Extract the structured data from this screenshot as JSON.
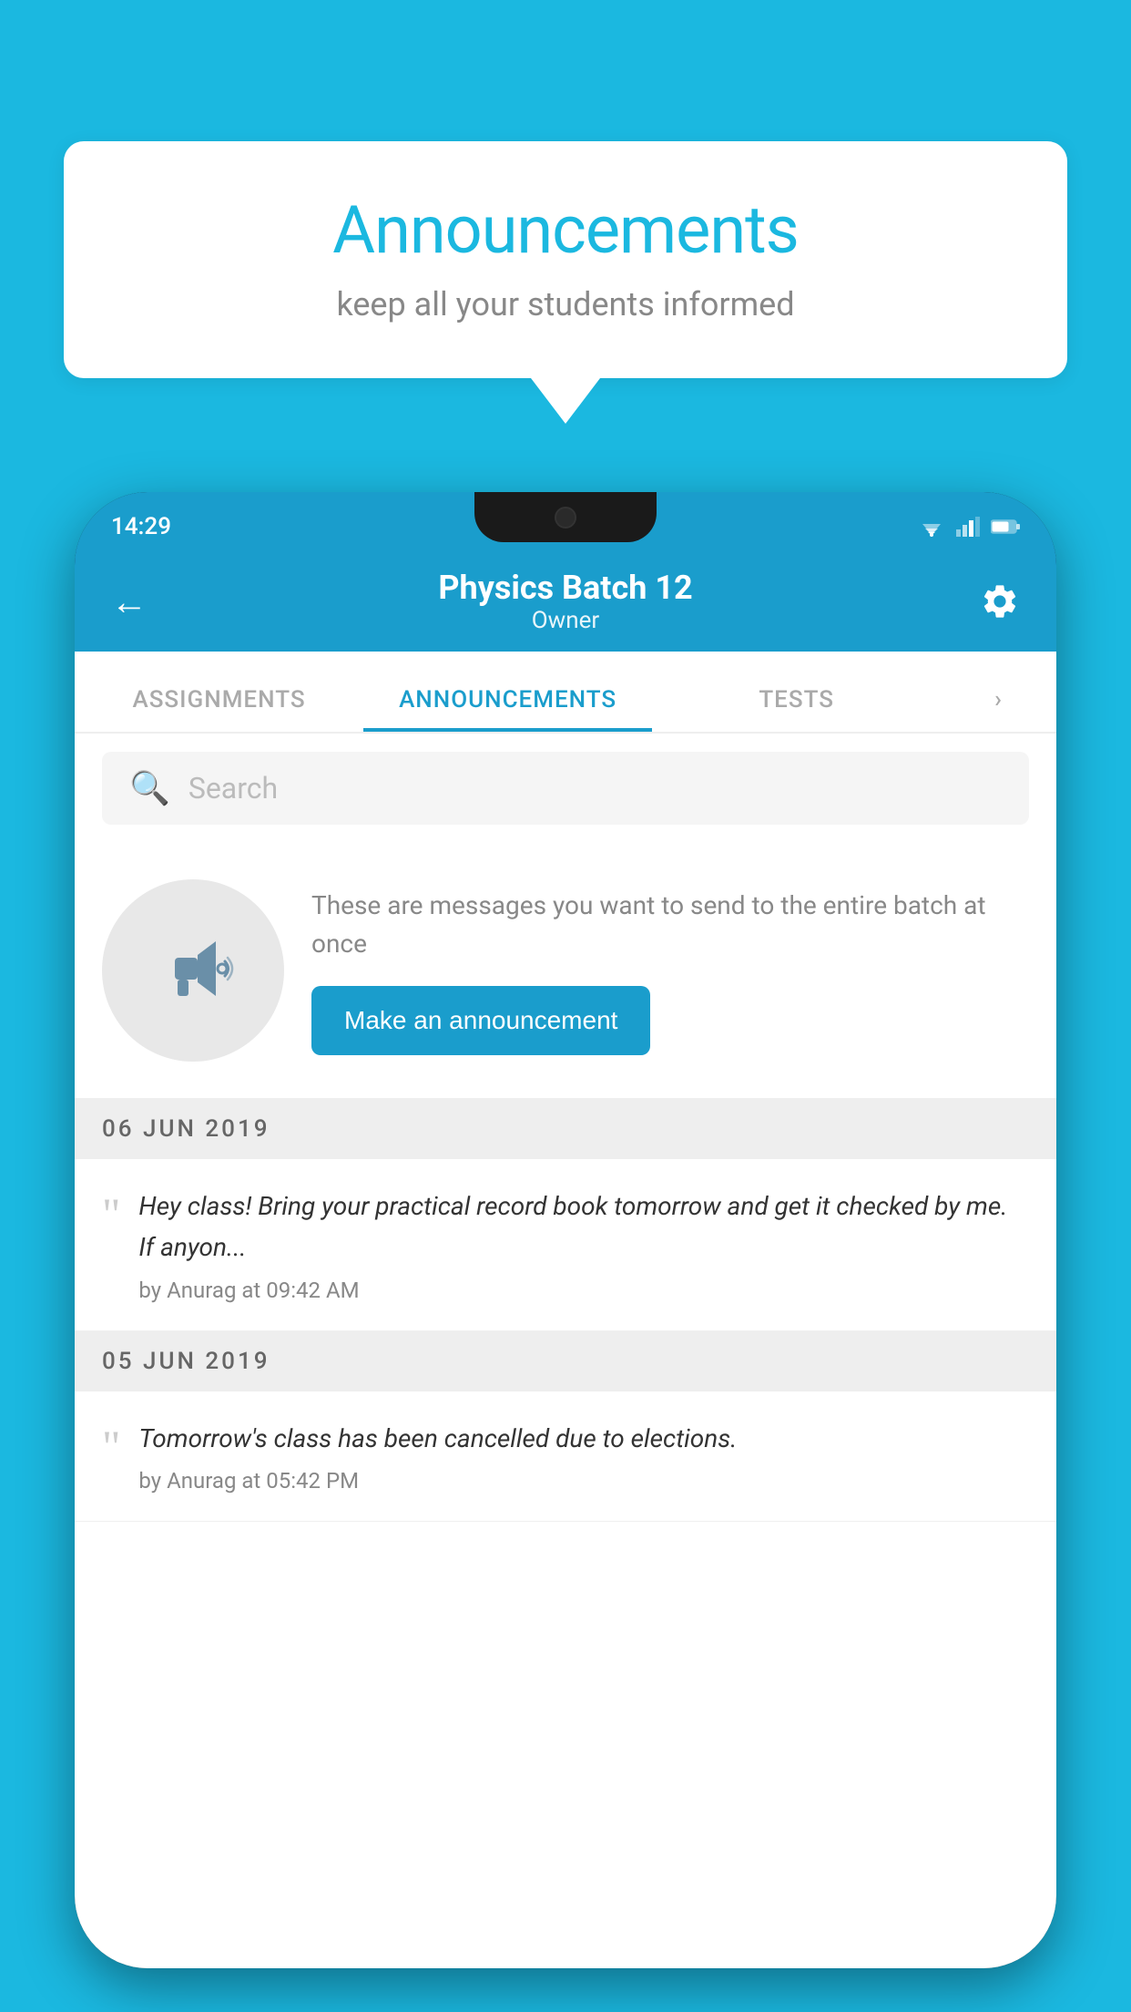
{
  "background_color": "#1bb8e0",
  "speech_bubble": {
    "title": "Announcements",
    "subtitle": "keep all your students informed"
  },
  "status_bar": {
    "time": "14:29"
  },
  "app_bar": {
    "title": "Physics Batch 12",
    "subtitle": "Owner",
    "back_label": "←"
  },
  "tabs": [
    {
      "label": "ASSIGNMENTS",
      "active": false
    },
    {
      "label": "ANNOUNCEMENTS",
      "active": true
    },
    {
      "label": "TESTS",
      "active": false
    },
    {
      "label": "›",
      "active": false
    }
  ],
  "search": {
    "placeholder": "Search"
  },
  "announcement_prompt": {
    "description": "These are messages you want to send to the entire batch at once",
    "button_label": "Make an announcement"
  },
  "date_groups": [
    {
      "date": "06  JUN  2019",
      "items": [
        {
          "text": "Hey class! Bring your practical record book tomorrow and get it checked by me. If anyon...",
          "meta": "by Anurag at 09:42 AM"
        }
      ]
    },
    {
      "date": "05  JUN  2019",
      "items": [
        {
          "text": "Tomorrow's class has been cancelled due to elections.",
          "meta": "by Anurag at 05:42 PM"
        }
      ]
    }
  ]
}
